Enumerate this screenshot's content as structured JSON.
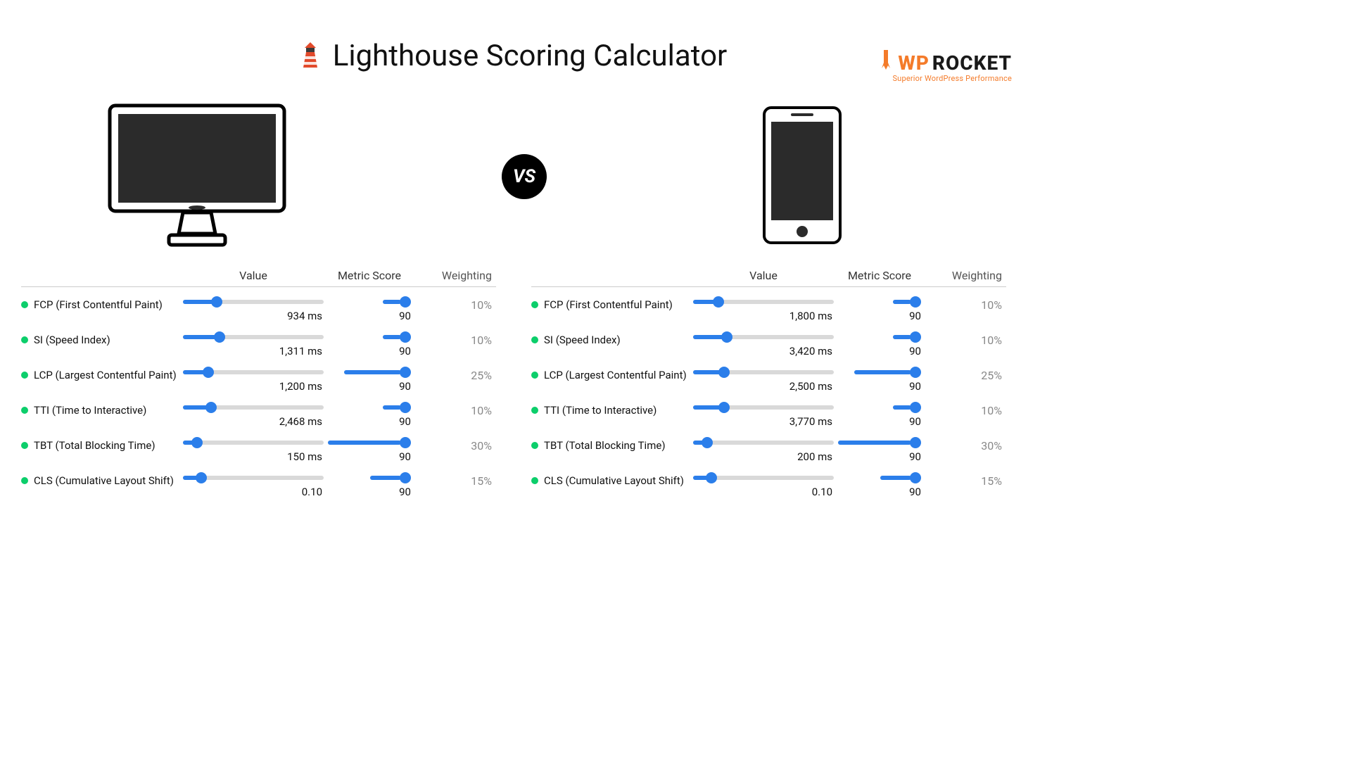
{
  "brand": {
    "wp": "WP",
    "rocket": "ROCKET",
    "tagline": "Superior WordPress Performance"
  },
  "title": "Lighthouse Scoring Calculator",
  "vs": "VS",
  "headers": {
    "value": "Value",
    "score": "Metric Score",
    "weight": "Weighting"
  },
  "desktop": {
    "metrics": [
      {
        "label": "FCP (First Contentful Paint)",
        "value": "934 ms",
        "pos": 24,
        "score": "90",
        "weight": "10%",
        "wclass": "w10"
      },
      {
        "label": "SI (Speed Index)",
        "value": "1,311 ms",
        "pos": 26,
        "score": "90",
        "weight": "10%",
        "wclass": "w10"
      },
      {
        "label": "LCP (Largest Contentful Paint)",
        "value": "1,200 ms",
        "pos": 18,
        "score": "90",
        "weight": "25%",
        "wclass": "w25"
      },
      {
        "label": "TTI (Time to Interactive)",
        "value": "2,468 ms",
        "pos": 20,
        "score": "90",
        "weight": "10%",
        "wclass": "w10"
      },
      {
        "label": "TBT (Total Blocking Time)",
        "value": "150 ms",
        "pos": 10,
        "score": "90",
        "weight": "30%",
        "wclass": "w30"
      },
      {
        "label": "CLS (Cumulative Layout Shift)",
        "value": "0.10",
        "pos": 13,
        "score": "90",
        "weight": "15%",
        "wclass": "w15"
      }
    ]
  },
  "mobile": {
    "metrics": [
      {
        "label": "FCP (First Contentful Paint)",
        "value": "1,800 ms",
        "pos": 18,
        "score": "90",
        "weight": "10%",
        "wclass": "w10"
      },
      {
        "label": "SI (Speed Index)",
        "value": "3,420 ms",
        "pos": 24,
        "score": "90",
        "weight": "10%",
        "wclass": "w10"
      },
      {
        "label": "LCP (Largest Contentful Paint)",
        "value": "2,500 ms",
        "pos": 22,
        "score": "90",
        "weight": "25%",
        "wclass": "w25"
      },
      {
        "label": "TTI (Time to Interactive)",
        "value": "3,770 ms",
        "pos": 22,
        "score": "90",
        "weight": "10%",
        "wclass": "w10"
      },
      {
        "label": "TBT (Total Blocking Time)",
        "value": "200 ms",
        "pos": 10,
        "score": "90",
        "weight": "30%",
        "wclass": "w30"
      },
      {
        "label": "CLS (Cumulative Layout Shift)",
        "value": "0.10",
        "pos": 13,
        "score": "90",
        "weight": "15%",
        "wclass": "w15"
      }
    ]
  }
}
